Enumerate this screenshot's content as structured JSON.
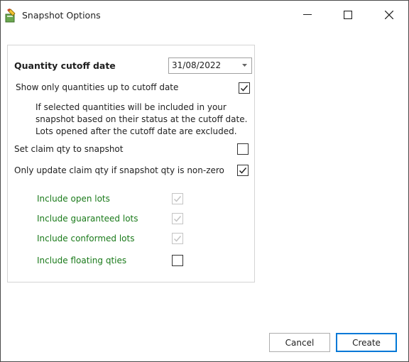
{
  "window": {
    "title": "Snapshot Options",
    "app_icon": "pencil-doc-icon"
  },
  "form": {
    "cutoff": {
      "label": "Quantity cutoff date",
      "value": "31/08/2022"
    },
    "show_only": {
      "label": "Show only quantities up to cutoff date",
      "checked": true
    },
    "note_lines": [
      "If selected quantities will be included in your",
      "snapshot based on their status at the cutoff date.",
      "Lots opened after the cutoff date are excluded."
    ],
    "set_claim": {
      "label": "Set claim qty to snapshot",
      "checked": false
    },
    "only_update": {
      "label": "Only update claim qty if snapshot qty is non-zero",
      "checked": true
    },
    "include_open": {
      "label": "Include open lots",
      "checked": true,
      "enabled": false
    },
    "include_guaranteed": {
      "label": "Include guaranteed lots",
      "checked": true,
      "enabled": false
    },
    "include_conformed": {
      "label": "Include conformed lots",
      "checked": true,
      "enabled": false
    },
    "include_floating": {
      "label": "Include floating qties",
      "checked": false,
      "enabled": true
    }
  },
  "buttons": {
    "cancel": "Cancel",
    "create": "Create"
  },
  "colors": {
    "accent": "#0078d7",
    "green_label": "#1a7a1a",
    "border": "#d4d4d4"
  }
}
